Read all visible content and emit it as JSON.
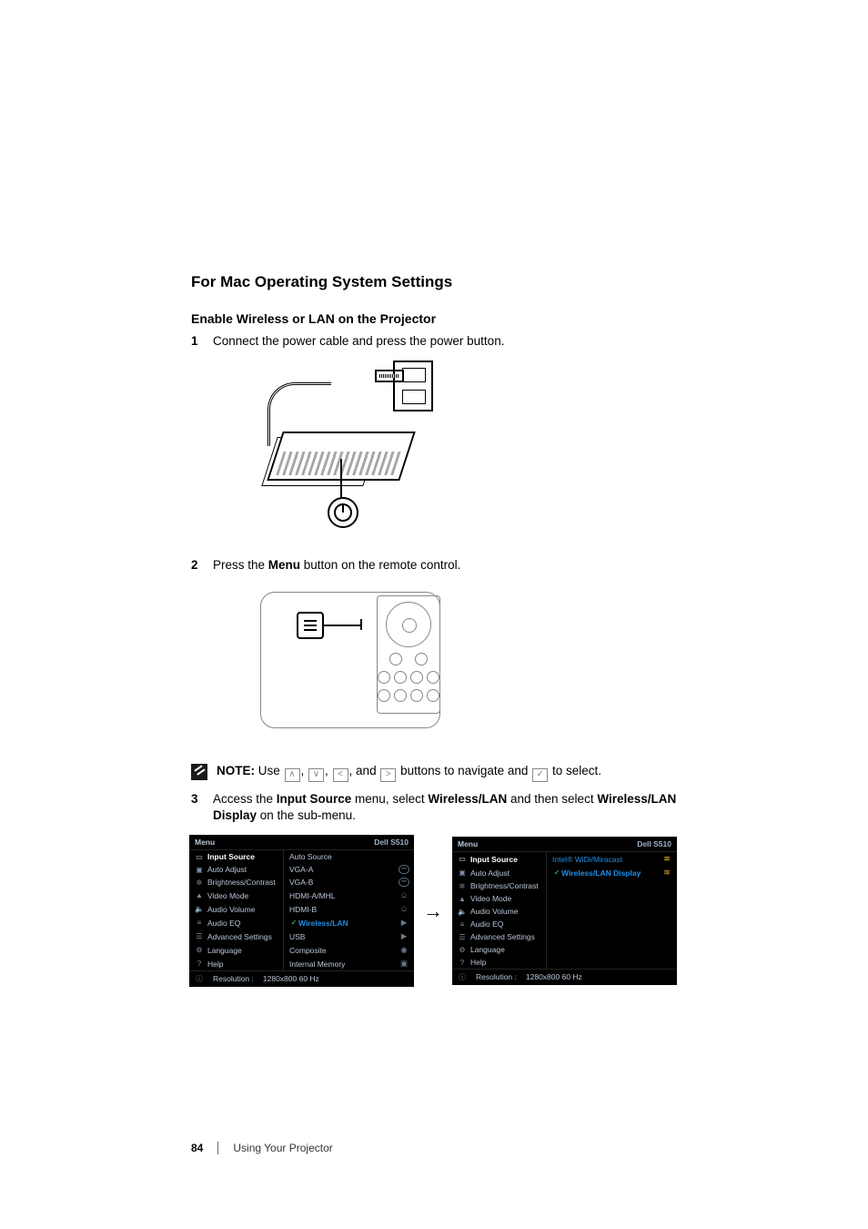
{
  "section_heading": "For Mac Operating System Settings",
  "sub_heading": "Enable Wireless or LAN on the Projector",
  "steps": {
    "s1_num": "1",
    "s1_text": "Connect the power cable and press the power button.",
    "s2_num": "2",
    "s2_text_a": "Press the ",
    "s2_bold": "Menu",
    "s2_text_b": " button on the remote control.",
    "s3_num": "3",
    "s3_text_a": "Access the ",
    "s3_bold_a": "Input Source",
    "s3_text_b": " menu, select ",
    "s3_bold_b": "Wireless/LAN",
    "s3_text_c": " and then select ",
    "s3_bold_c": "Wireless/LAN Display",
    "s3_text_d": " on the sub-menu."
  },
  "note": {
    "label": "NOTE:",
    "a": " Use ",
    "b": ", ",
    "c": ", ",
    "d": ", and ",
    "e": " buttons to navigate and ",
    "f": " to select."
  },
  "keycaps": {
    "up": "∧",
    "down": "∨",
    "left": "<",
    "right": ">",
    "ok": "✓"
  },
  "osd": {
    "menu_title": "Menu",
    "model": "Dell S510",
    "left_items": [
      "Input Source",
      "Auto Adjust",
      "Brightness/Contrast",
      "Video Mode",
      "Audio Volume",
      "Audio EQ",
      "Advanced Settings",
      "Language",
      "Help"
    ],
    "left_icons": [
      "▭",
      "▣",
      "✲",
      "▲",
      "🔈",
      "≡",
      "☰",
      "⚙",
      "?"
    ],
    "sources": [
      {
        "label": "Auto Source",
        "icon": ""
      },
      {
        "label": "VGA-A",
        "icon": "tag"
      },
      {
        "label": "VGA-B",
        "icon": "tag"
      },
      {
        "label": "HDMI-A/MHL",
        "icon": "⎐"
      },
      {
        "label": "HDMI-B",
        "icon": "⎐"
      },
      {
        "label": "Wireless/LAN",
        "icon": "▶",
        "selected": true
      },
      {
        "label": "USB",
        "icon": "▶"
      },
      {
        "label": "Composite",
        "icon": "◉"
      },
      {
        "label": "Internal Memory",
        "icon": "▣"
      }
    ],
    "submenu_items": [
      {
        "label": "Intel® WiDi/Miracast",
        "icon": "wifi"
      },
      {
        "label": "Wireless/LAN Display",
        "icon": "wifi2",
        "selected": true
      }
    ],
    "status_label": "Resolution :",
    "status_value": "1280x800 60 Hz"
  },
  "footer": {
    "page_number": "84",
    "chapter": "Using Your Projector"
  }
}
